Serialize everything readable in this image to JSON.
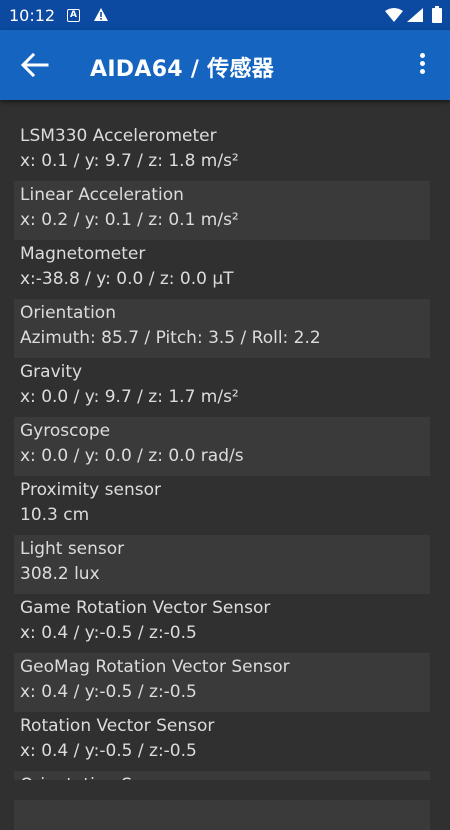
{
  "status_bar": {
    "time": "10:12",
    "notification_a": "A",
    "icons": [
      "notification-a-icon",
      "warning-icon",
      "wifi-icon",
      "signal-icon",
      "battery-icon"
    ]
  },
  "app_bar": {
    "title": "AIDA64  /  传感器",
    "back_icon": "arrow-left-icon",
    "menu_icon": "more-vert-icon"
  },
  "colors": {
    "status_bar": "#0b4aa0",
    "app_bar": "#1565c0",
    "background": "#303030",
    "alt_row": "#3a3a3a",
    "text": "#dcdcdc"
  },
  "sensors": [
    {
      "name": "LSM330 Accelerometer",
      "value": "x: 0.1 / y: 9.7 / z: 1.8 m/s²"
    },
    {
      "name": "Linear Acceleration",
      "value": "x: 0.2 / y: 0.1 / z: 0.1 m/s²"
    },
    {
      "name": "Magnetometer",
      "value": "x:-38.8 / y: 0.0 / z: 0.0 µT"
    },
    {
      "name": "Orientation",
      "value": "Azimuth: 85.7 / Pitch: 3.5 / Roll: 2.2"
    },
    {
      "name": "Gravity",
      "value": "x: 0.0 / y: 9.7 / z: 1.7 m/s²"
    },
    {
      "name": "Gyroscope",
      "value": "x: 0.0 / y: 0.0 / z: 0.0 rad/s"
    },
    {
      "name": "Proximity sensor",
      "value": "10.3 cm"
    },
    {
      "name": "Light sensor",
      "value": "308.2 lux"
    },
    {
      "name": "Game Rotation Vector Sensor",
      "value": "x: 0.4 / y:-0.5 / z:-0.5"
    },
    {
      "name": "GeoMag Rotation Vector Sensor",
      "value": "x: 0.4 / y:-0.5 / z:-0.5"
    },
    {
      "name": "Rotation Vector Sensor",
      "value": "x: 0.4 / y:-0.5 / z:-0.5"
    },
    {
      "name": "Orientation Sensor",
      "value": ""
    }
  ]
}
